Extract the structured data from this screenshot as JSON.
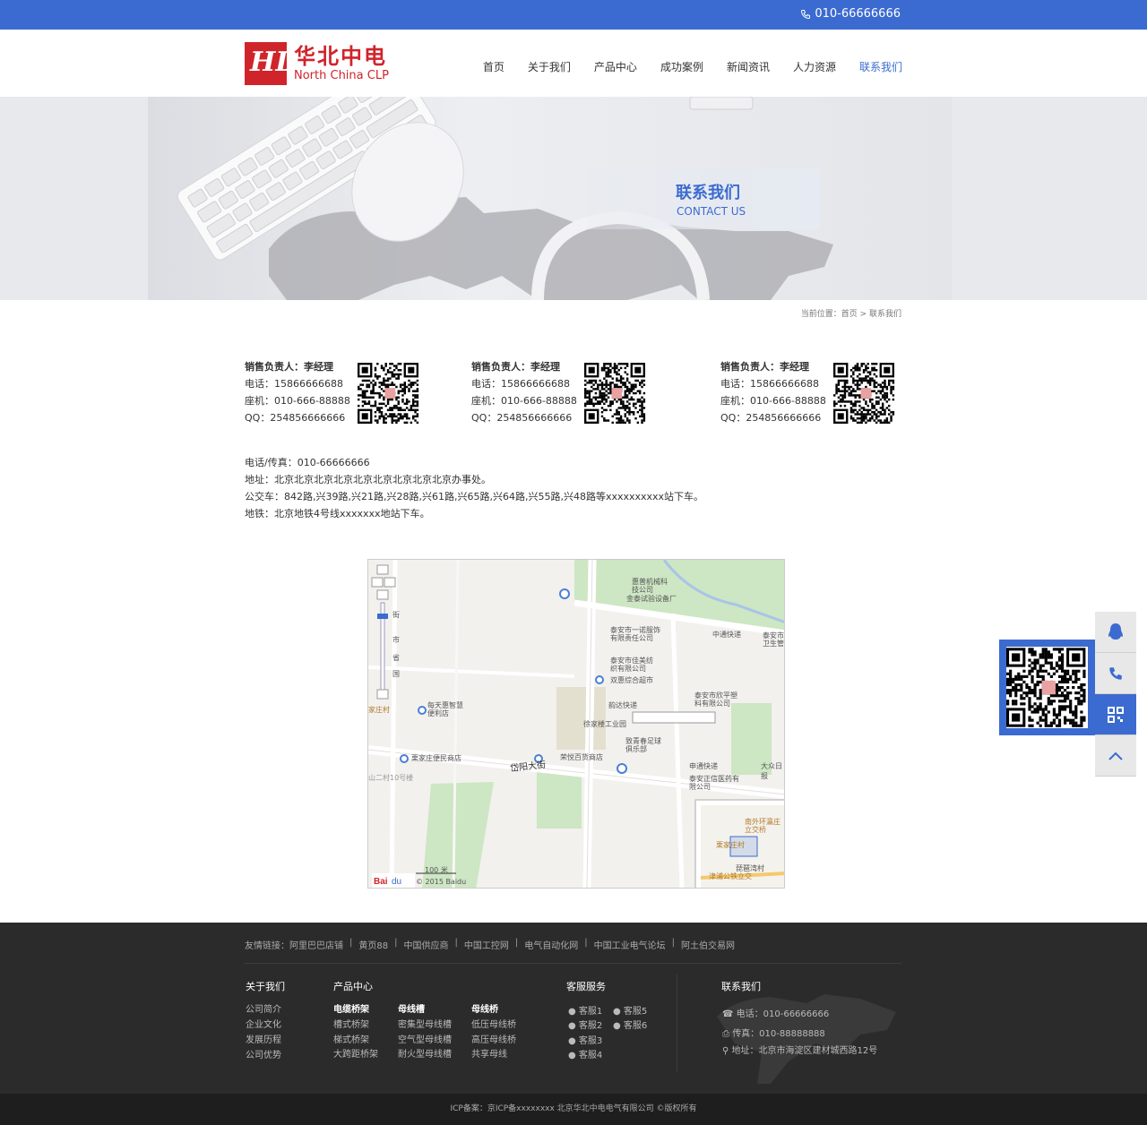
{
  "topbar": {
    "phone": "010-66666666",
    "phone_icon": "phone-icon"
  },
  "logo": {
    "cn": "华北中电",
    "en": "North China CLP",
    "mark": "HD"
  },
  "nav": [
    {
      "label": "首页"
    },
    {
      "label": "关于我们"
    },
    {
      "label": "产品中心"
    },
    {
      "label": "成功案例"
    },
    {
      "label": "新闻资讯"
    },
    {
      "label": "人力资源"
    },
    {
      "label": "联系我们"
    }
  ],
  "banner": {
    "cn": "联系我们",
    "en": "CONTACT US"
  },
  "breadcrumb": "当前位置：首页 > 联系我们",
  "contacts": [
    {
      "name": "销售负责人：李经理",
      "tel": "电话：15866666688",
      "landline": "座机：010-666-88888",
      "qq": "QQ：254856666666"
    },
    {
      "name": "销售负责人：李经理",
      "tel": "电话：15866666688",
      "landline": "座机：010-666-88888",
      "qq": "QQ：254856666666"
    },
    {
      "name": "销售负责人：李经理",
      "tel": "电话：15866666688",
      "landline": "座机：010-666-88888",
      "qq": "QQ：254856666666"
    }
  ],
  "info": {
    "fax": "电话/传真：010-66666666",
    "address": "地址：北京北京北京北京北京北京北京北京北京办事处。",
    "bus": "公交车：842路,兴39路,兴21路,兴28路,兴61路,兴65路,兴64路,兴55路,兴48路等xxxxxxxxxx站下车。",
    "subway": "地铁：北京地铁4号线xxxxxxx地站下车。"
  },
  "map": {
    "labels": [
      "惠普机械科技公司",
      "金泰试验设备厂",
      "泰安市一诺服饰有限责任公司",
      "中通快递",
      "泰安市卫生管",
      "泰安市佳美纺织有限公司",
      "双惠综合超市",
      "泰安市欣平塑料有限公司",
      "韵达快递",
      "每天惠智慧便利店",
      "家庄村",
      "徐家楼工业园",
      "致青春足球俱乐部",
      "栗家庄便民商店",
      "荣悦百货商店",
      "岱阳大街",
      "申通快递",
      "泰安正信医药有限公司",
      "大众日报",
      "山二村10号楼",
      "南外环瀛庄立交桥",
      "栗家庄村",
      "琵琶湾村",
      "津浦公铁立交",
      "100 米",
      "© 2015 Baidu"
    ],
    "nav_letters": [
      "街",
      "市",
      "省",
      "国"
    ]
  },
  "footer": {
    "friend_label": "友情链接：",
    "friends": [
      "阿里巴巴店铺",
      "黄页88",
      "中国供应商",
      "中国工控网",
      "电气自动化网",
      "中国工业电气论坛",
      "阿土伯交易网"
    ],
    "about": {
      "title": "关于我们",
      "items": [
        "公司简介",
        "企业文化",
        "发展历程",
        "公司优势"
      ]
    },
    "products": {
      "title": "产品中心",
      "cols": [
        {
          "head": "电缆桥架",
          "items": [
            "槽式桥架",
            "梯式桥架",
            "大跨距桥架"
          ]
        },
        {
          "head": "母线槽",
          "items": [
            "密集型母线槽",
            "空气型母线槽",
            "耐火型母线槽"
          ]
        },
        {
          "head": "母线桥",
          "items": [
            "低压母线桥",
            "高压母线桥",
            "共享母线"
          ]
        }
      ]
    },
    "service": {
      "title": "客服服务",
      "items": [
        "客服1",
        "客服5",
        "客服2",
        "客服6",
        "客服3",
        "客服4"
      ]
    },
    "contact": {
      "title": "联系我们",
      "tel": "电话：010-66666666",
      "fax": "传真：010-88888888",
      "addr": "地址：北京市海淀区建材城西路12号"
    },
    "copyright": "ICP备案：京ICP备xxxxxxxx 北京华北中电电气有限公司 ©版权所有"
  },
  "side": [
    "qq-icon",
    "phone-icon",
    "qrcode-icon",
    "back-to-top-icon"
  ],
  "colors": {
    "accent": "#3b6bd0",
    "brand_red": "#d0242b",
    "footer_bg": "#2b2b2b"
  }
}
